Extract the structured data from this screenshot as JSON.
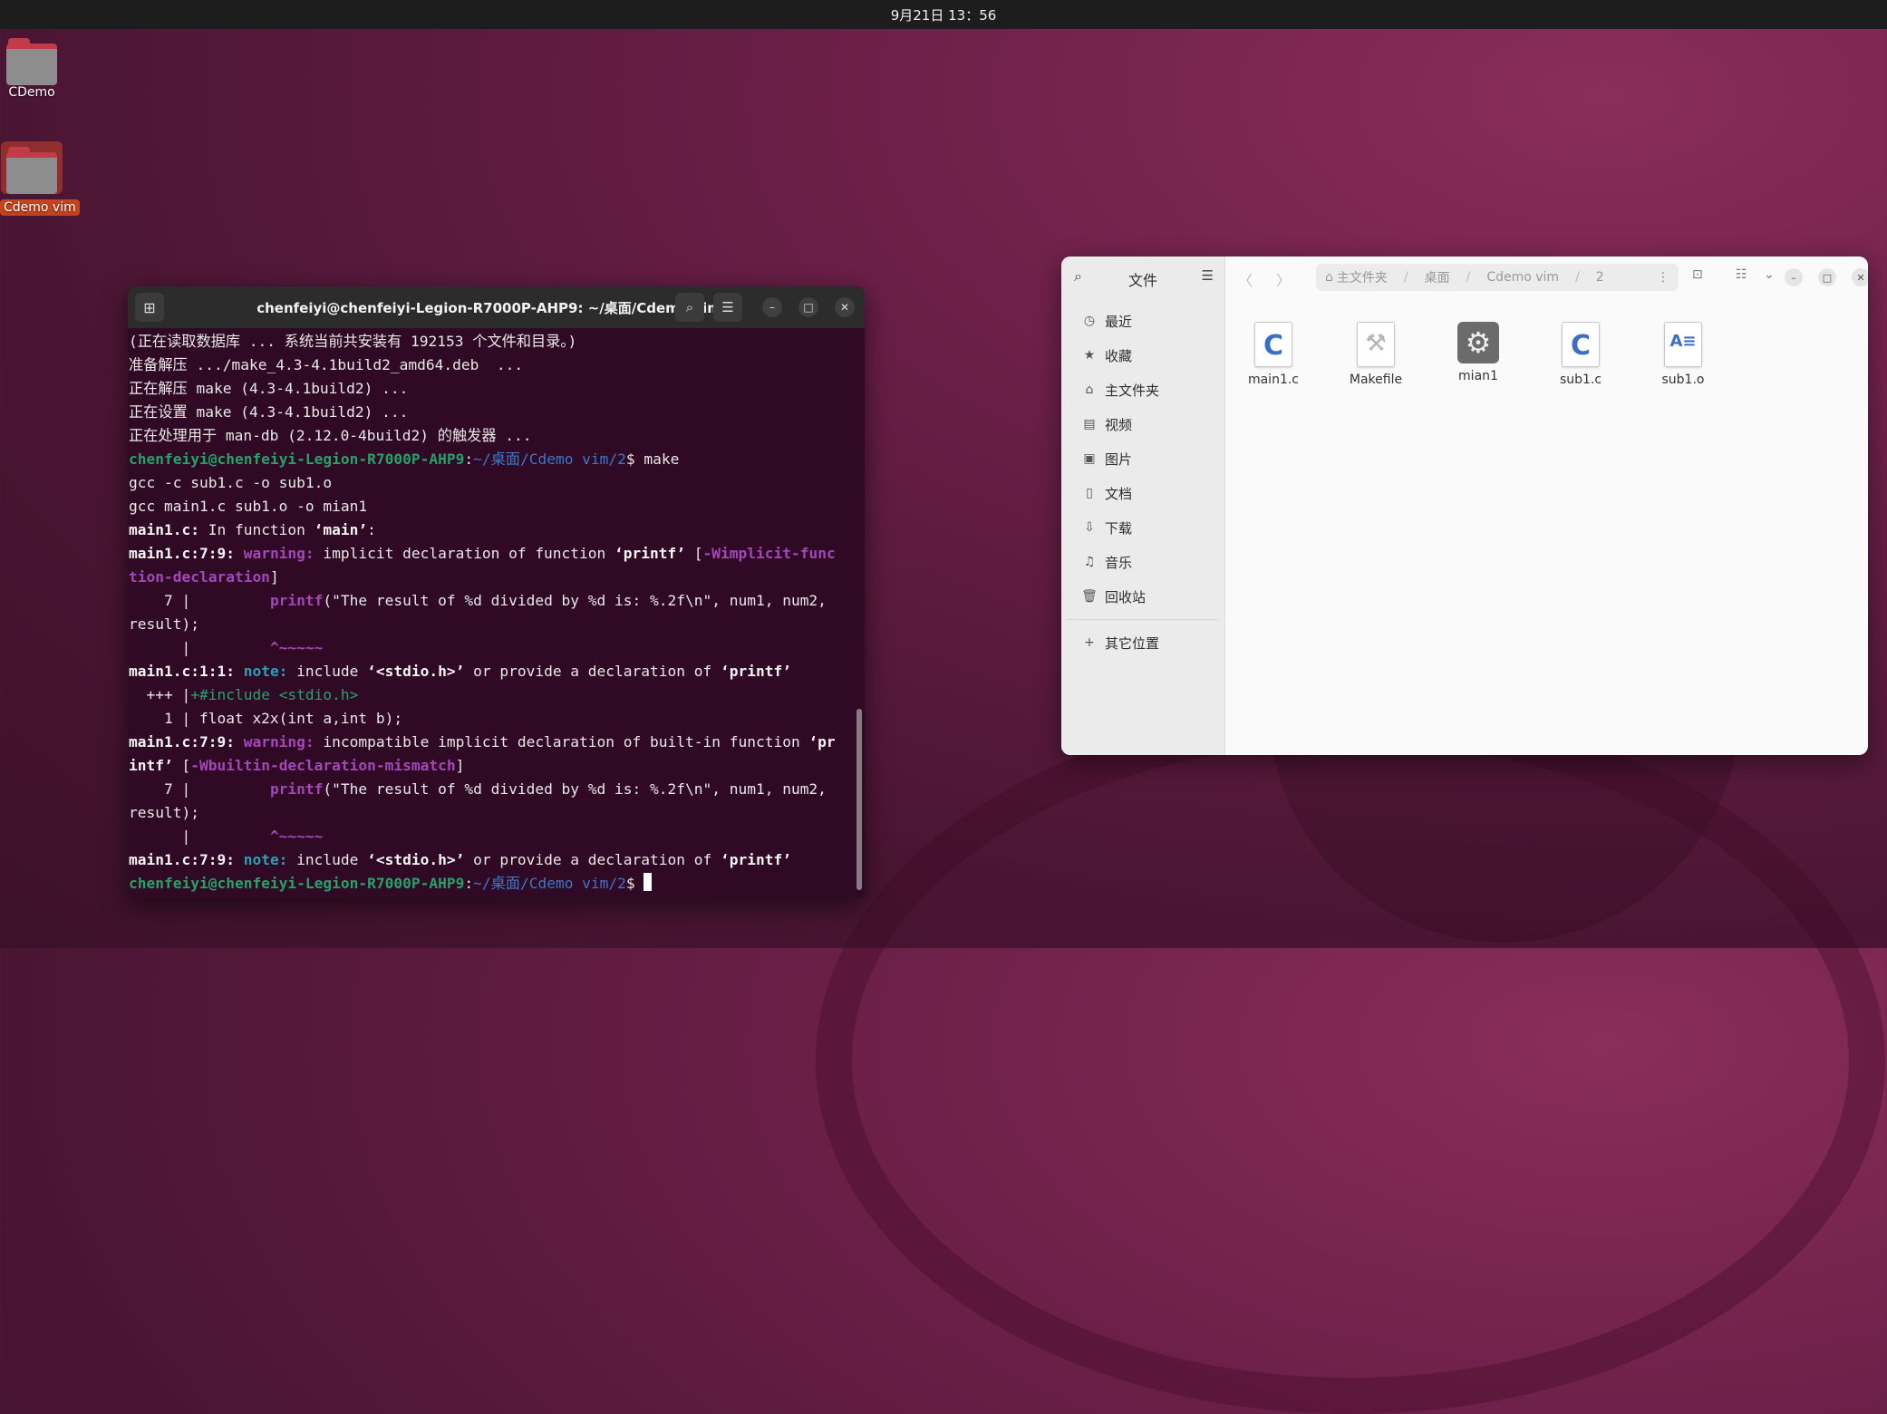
{
  "topbar": {
    "clock": "9月21日 13：56"
  },
  "desktop": {
    "icons": [
      {
        "label": "CDemo"
      },
      {
        "label": "Cdemo vim"
      }
    ]
  },
  "terminal": {
    "title": "chenfeiyi@chenfeiyi-Legion-R7000P-AHP9: ~/桌面/Cdemo vim/2",
    "lines": {
      "l1": "(正在读取数据库 ... 系统当前共安装有 192153 个文件和目录。)",
      "l2": "准备解压 .../make_4.3-4.1build2_amd64.deb  ...",
      "l3": "正在解压 make (4.3-4.1build2) ...",
      "l4": "正在设置 make (4.3-4.1build2) ...",
      "l5": "正在处理用于 man-db (2.12.0-4build2) 的触发器 ...",
      "prompt_user": "chenfeiyi@chenfeiyi-Legion-R7000P-AHP9",
      "prompt_path": "~/桌面/Cdemo vim/2",
      "cmd_make": "make",
      "l7": "gcc -c sub1.c -o sub1.o",
      "l8": "gcc main1.c sub1.o -o mian1",
      "l9a": "main1.c:",
      "l9b": " In function ",
      "l9c": "‘main’",
      "l9d": ":",
      "w_loc": "main1.c:7:9:",
      "warning": "warning:",
      "w1_text": " implicit declaration of function ",
      "w1_fn": "‘printf’",
      "w1_flag_a": "-Wimplicit-func",
      "w1_flag_b": "tion-declaration",
      "code_no": "    7 |         ",
      "code_fn": "printf",
      "code_rest": "(\"The result of %d divided by %d is: %.2f\\n\", num1, num2,",
      "code_cont": "result);",
      "caret_pre": "      |         ",
      "caret": "^~~~~~",
      "note1_loc": "main1.c:1:1:",
      "note": "note:",
      "note1_text_a": " include ",
      "note1_hdr": "‘<stdio.h>’",
      "note1_text_b": " or provide a declaration of ",
      "note1_fn": "‘printf’",
      "fix_pre": "  +++ |",
      "fix_text": "+#include <stdio.h>",
      "line1": "    1 | float x2x(int a,int b);",
      "w2_text": " incompatible implicit declaration of built-in function ",
      "w2_fn_a": "‘pr",
      "w2_fn_b": "intf’",
      "w2_flag": "-Wbuiltin-declaration-mismatch",
      "note2_loc": "main1.c:7:9:"
    }
  },
  "files": {
    "sidebar_title": "文件",
    "sidebar": [
      {
        "label": "最近",
        "icon": "clock-icon"
      },
      {
        "label": "收藏",
        "icon": "star-icon"
      },
      {
        "label": "主文件夹",
        "icon": "home-icon"
      },
      {
        "label": "视频",
        "icon": "video-icon"
      },
      {
        "label": "图片",
        "icon": "image-icon"
      },
      {
        "label": "文档",
        "icon": "document-icon"
      },
      {
        "label": "下载",
        "icon": "download-icon"
      },
      {
        "label": "音乐",
        "icon": "music-icon"
      },
      {
        "label": "回收站",
        "icon": "trash-icon"
      },
      {
        "label": "其它位置",
        "icon": "plus-icon"
      }
    ],
    "breadcrumb": [
      "主文件夹",
      "桌面",
      "Cdemo vim",
      "2"
    ],
    "items": [
      {
        "name": "main1.c",
        "type": "c-source"
      },
      {
        "name": "Makefile",
        "type": "makefile"
      },
      {
        "name": "mian1",
        "type": "executable"
      },
      {
        "name": "sub1.c",
        "type": "c-source"
      },
      {
        "name": "sub1.o",
        "type": "object"
      }
    ]
  }
}
